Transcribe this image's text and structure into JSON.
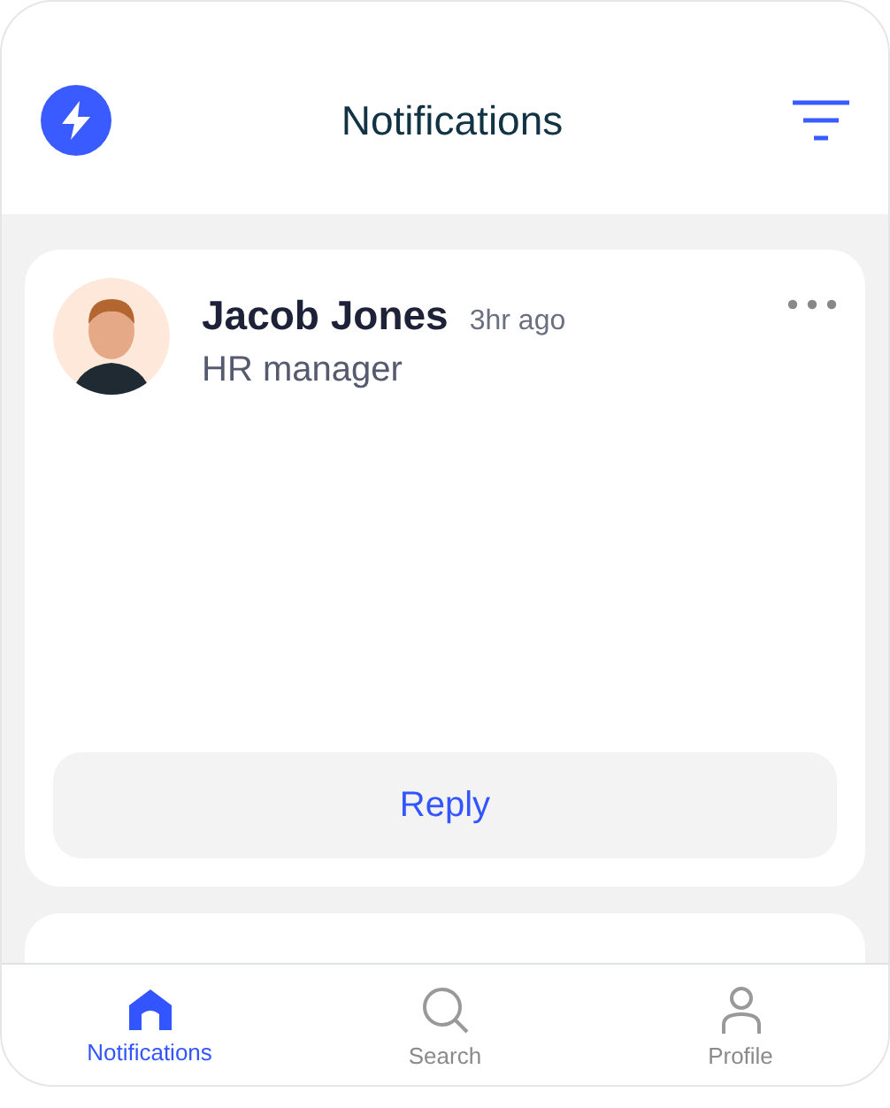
{
  "header": {
    "title": "Notifications"
  },
  "notifications": [
    {
      "name": "Jacob Jones",
      "time": "3hr ago",
      "role": "HR manager",
      "action": "Reply"
    }
  ],
  "nav": [
    {
      "label": "Notifications",
      "kind": "home",
      "selected": true
    },
    {
      "label": "Search",
      "kind": "search",
      "selected": false
    },
    {
      "label": "Profile",
      "kind": "profile",
      "selected": false
    }
  ]
}
